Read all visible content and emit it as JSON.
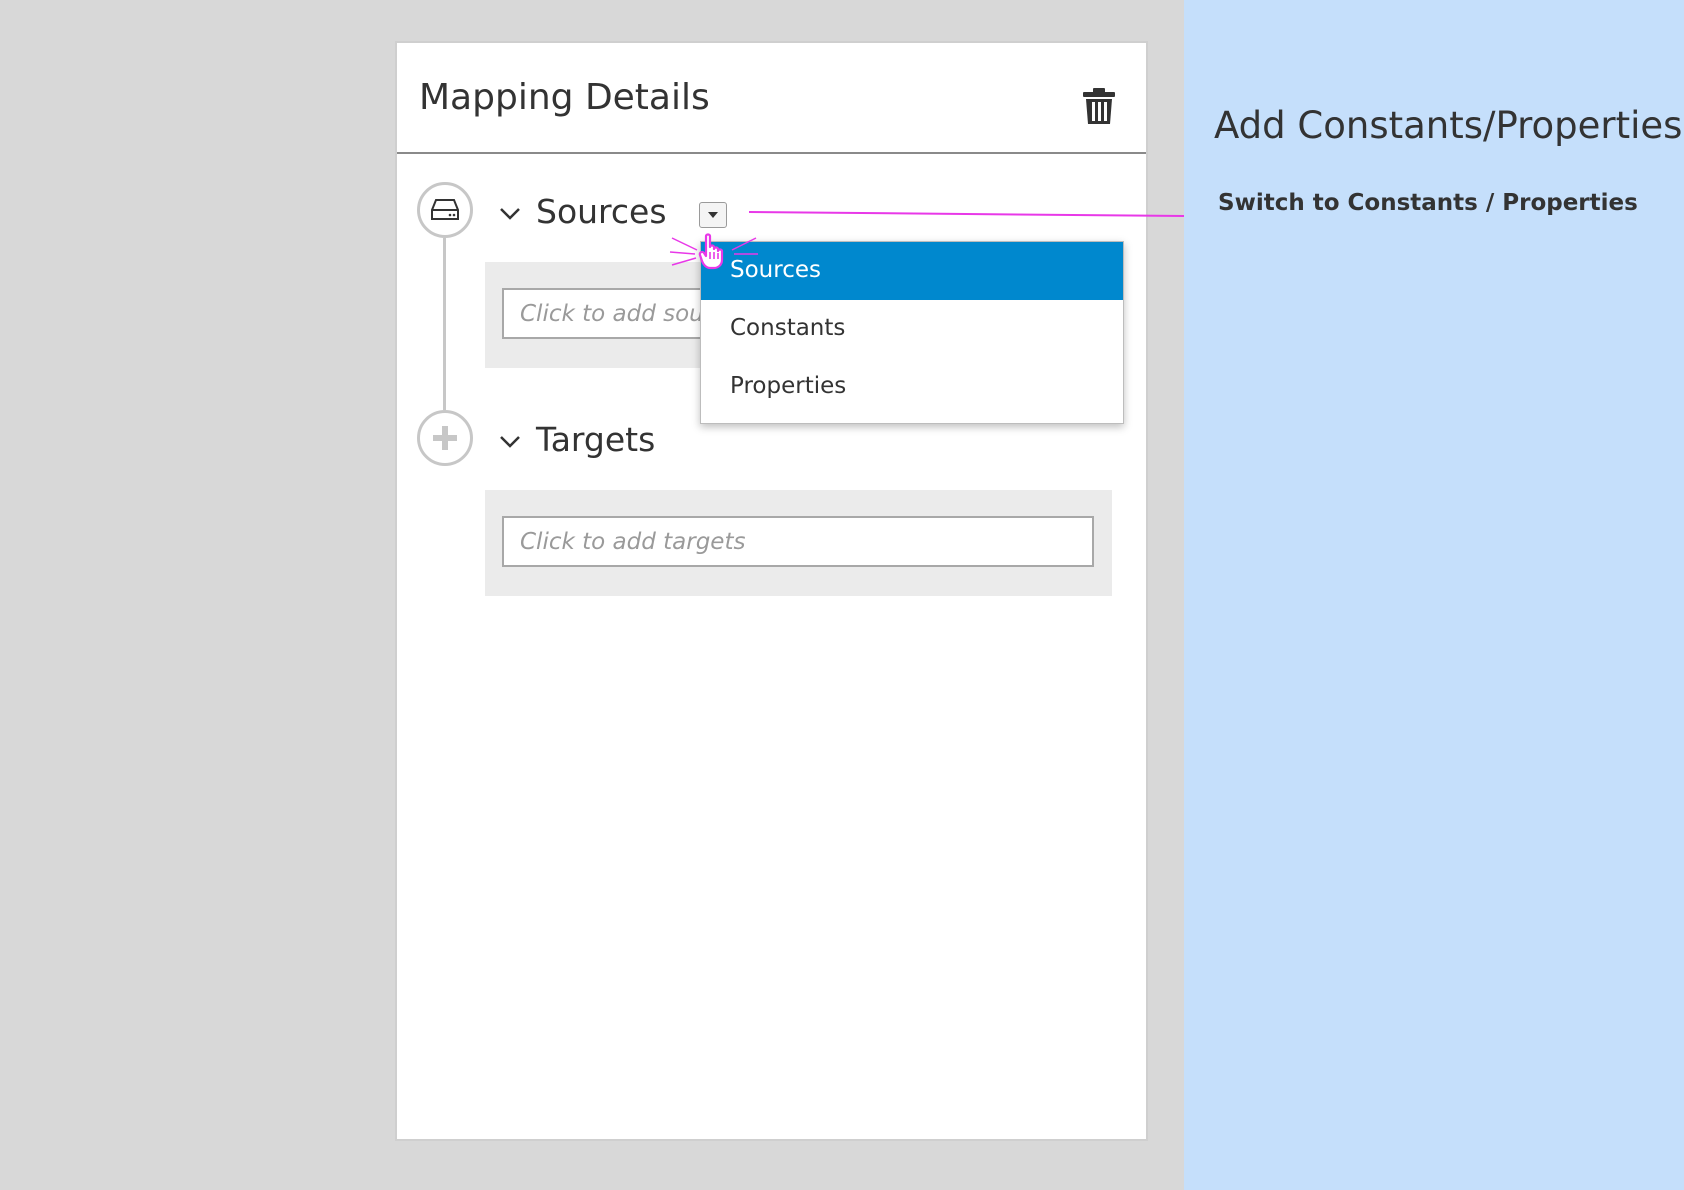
{
  "notes": {
    "title": "Add Constants/Properties",
    "note": "Switch to Constants / Properties"
  },
  "panel": {
    "title": "Mapping Details",
    "delete_icon": "trash-icon"
  },
  "sources": {
    "title": "Sources",
    "node_icon": "drive-icon",
    "placeholder": "Click to add sour"
  },
  "targets": {
    "title": "Targets",
    "node_icon": "plus-icon",
    "placeholder": "Click to add targets"
  },
  "dropdown": {
    "items": [
      "Sources",
      "Constants",
      "Properties"
    ],
    "selected": "Sources"
  },
  "colors": {
    "accent": "#0088ce",
    "annotation": "#e838e8",
    "notes_bg": "#c5dffb"
  }
}
